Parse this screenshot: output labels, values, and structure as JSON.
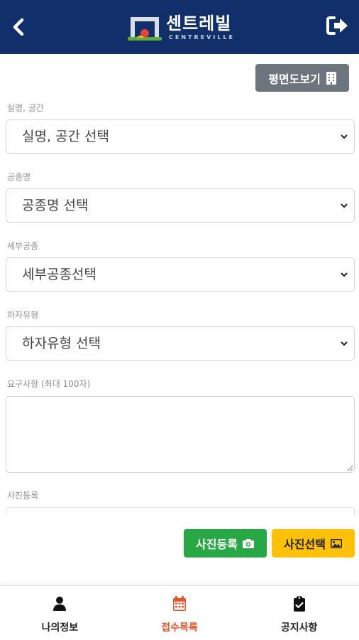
{
  "header": {
    "back_icon": "chevron-left-icon",
    "logo_text": "센트레빌",
    "logo_subtext": "CENTREVILLE",
    "logout_icon": "sign-out-icon",
    "bg_color": "#102f6b"
  },
  "floor_plan_button": {
    "label": "평면도보기",
    "icon": "building-icon"
  },
  "form": {
    "room": {
      "label": "실명, 공간",
      "selected": "실명, 공간 선택"
    },
    "trade": {
      "label": "공종명",
      "selected": "공종명 선택"
    },
    "sub_trade": {
      "label": "세부공종",
      "selected": "세부공종선택"
    },
    "defect_type": {
      "label": "하자유형",
      "selected": "하자유형 선택"
    },
    "request": {
      "label": "요구사항 (최대 100자)",
      "value": ""
    },
    "photos": {
      "label": "사진등록"
    }
  },
  "buttons": {
    "photo_register": {
      "label": "사진등록",
      "icon": "camera-icon",
      "color": "#28a745"
    },
    "photo_select": {
      "label": "사진선택",
      "icon": "image-icon",
      "color": "#ffc107"
    }
  },
  "bottom_nav": {
    "my_info": {
      "label": "나의정보",
      "icon": "user-icon"
    },
    "receipt_list": {
      "label": "접수목록",
      "icon": "calendar-icon",
      "active": true,
      "color": "#e8542a"
    },
    "notices": {
      "label": "공지사항",
      "icon": "clipboard-check-icon"
    }
  }
}
